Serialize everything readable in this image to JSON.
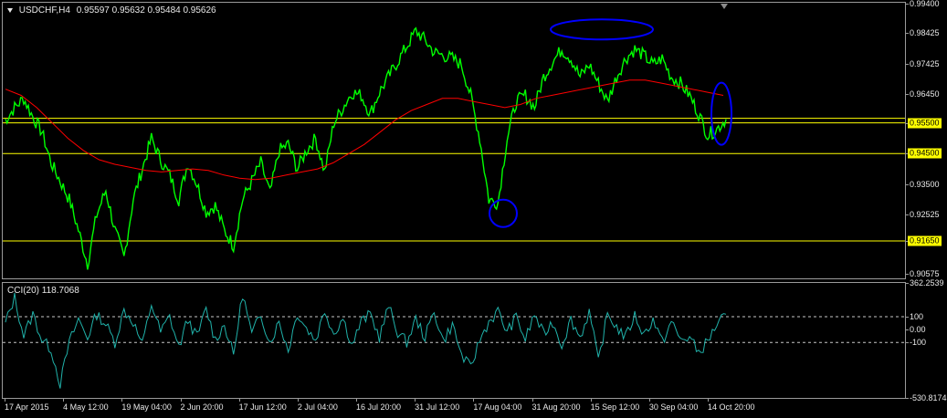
{
  "header": {
    "symbol": "USDCHF,H4",
    "ohlc": "0.95597 0.95632 0.95484 0.95626",
    "cci_label": "CCI(20) 118.7068"
  },
  "colors": {
    "price": "#00ff00",
    "ma": "#ff0000",
    "hline": "#ffff00",
    "ellipse": "#0000ff",
    "cci": "#20b2aa",
    "grid": "#9a9a9a"
  },
  "price_axis": {
    "ticks": [
      "0.99400",
      "0.98425",
      "0.97425",
      "0.96450",
      "0.95500",
      "0.94500",
      "0.93500",
      "0.92525",
      "0.91650",
      "0.90575"
    ],
    "ylim": [
      0.9043,
      0.9942
    ]
  },
  "cci_axis": {
    "ticks": [
      "362.2539",
      "100",
      "0.00",
      "-100",
      "-530.8174"
    ],
    "ylim": [
      -530.8174,
      362.2539
    ]
  },
  "time_axis": {
    "labels": [
      "17 Apr 2015",
      "4 May 12:00",
      "19 May 04:00",
      "2 Jun 20:00",
      "17 Jun 12:00",
      "2 Jul 04:00",
      "16 Jul 20:00",
      "31 Jul 12:00",
      "17 Aug 04:00",
      "31 Aug 20:00",
      "15 Sep 12:00",
      "30 Sep 04:00",
      "14 Oct 20:00"
    ]
  },
  "chart_data": {
    "type": "line",
    "title": "USDCHF,H4",
    "x": [
      "17 Apr 2015",
      "4 May 12:00",
      "19 May 04:00",
      "2 Jun 20:00",
      "17 Jun 12:00",
      "2 Jul 04:00",
      "16 Jul 20:00",
      "31 Jul 12:00",
      "17 Aug 04:00",
      "31 Aug 20:00",
      "15 Sep 12:00",
      "30 Sep 04:00",
      "14 Oct 20:00"
    ],
    "ylim": [
      0.9043,
      0.9942
    ],
    "grid": false,
    "series": [
      {
        "role": "price",
        "color": "#00ff00",
        "values": [
          0.956,
          0.96,
          0.963,
          0.957,
          0.952,
          0.942,
          0.936,
          0.93,
          0.92,
          0.909,
          0.925,
          0.933,
          0.92,
          0.911,
          0.93,
          0.94,
          0.95,
          0.943,
          0.938,
          0.93,
          0.942,
          0.935,
          0.926,
          0.928,
          0.92,
          0.915,
          0.93,
          0.936,
          0.942,
          0.932,
          0.946,
          0.948,
          0.94,
          0.946,
          0.95,
          0.939,
          0.955,
          0.96,
          0.965,
          0.964,
          0.958,
          0.965,
          0.97,
          0.975,
          0.98,
          0.985,
          0.982,
          0.978,
          0.977,
          0.976,
          0.974,
          0.964,
          0.95,
          0.93,
          0.929,
          0.95,
          0.962,
          0.964,
          0.96,
          0.97,
          0.975,
          0.979,
          0.976,
          0.97,
          0.974,
          0.968,
          0.962,
          0.97,
          0.976,
          0.979,
          0.977,
          0.974,
          0.976,
          0.97,
          0.968,
          0.964,
          0.958,
          0.951,
          0.953,
          0.9562
        ]
      },
      {
        "role": "moving-average",
        "color": "#ff0000",
        "values": [
          0.966,
          0.964,
          0.96,
          0.955,
          0.95,
          0.946,
          0.943,
          0.9415,
          0.9405,
          0.9395,
          0.939,
          0.9395,
          0.94,
          0.9395,
          0.938,
          0.937,
          0.9365,
          0.937,
          0.938,
          0.939,
          0.94,
          0.942,
          0.945,
          0.948,
          0.952,
          0.956,
          0.959,
          0.961,
          0.963,
          0.963,
          0.962,
          0.961,
          0.96,
          0.961,
          0.963,
          0.964,
          0.965,
          0.966,
          0.967,
          0.968,
          0.969,
          0.969,
          0.968,
          0.967,
          0.966,
          0.965,
          0.964
        ]
      }
    ],
    "horizontal_lines": [
      {
        "value": 0.9565,
        "label": ""
      },
      {
        "value": 0.955,
        "label": "0.95500"
      },
      {
        "value": 0.945,
        "label": "0.94500"
      },
      {
        "value": 0.9165,
        "label": "0.91650"
      }
    ],
    "cci": {
      "name": "CCI(20)",
      "last": 118.7068,
      "levels": [
        100,
        -100
      ],
      "ylim": [
        -530.8174,
        362.2539
      ],
      "values": [
        50,
        250,
        -50,
        120,
        -80,
        -150,
        -420,
        -100,
        80,
        -60,
        120,
        40,
        -100,
        150,
        60,
        -120,
        200,
        -20,
        100,
        -140,
        80,
        -60,
        160,
        -80,
        40,
        -200,
        280,
        -40,
        120,
        -100,
        60,
        -160,
        130,
        10,
        -80,
        150,
        -30,
        90,
        -120,
        60,
        120,
        -60,
        180,
        -20,
        -100,
        80,
        -60,
        140,
        -90,
        40,
        -200,
        -300,
        -80,
        60,
        140,
        -20,
        100,
        -80,
        120,
        -40,
        60,
        -120,
        80,
        -60,
        140,
        -250,
        120,
        20,
        -60,
        110,
        -40,
        80,
        -100,
        60,
        -80,
        -60,
        -180,
        -90,
        40,
        119
      ]
    },
    "annotations": [
      {
        "shape": "ellipse",
        "near": "31 Aug 20:00 - 15 Sep 12:00 highs",
        "color": "#0000ff"
      },
      {
        "shape": "ellipse",
        "near": "17 Aug 04:00 low",
        "color": "#0000ff"
      },
      {
        "shape": "ellipse",
        "near": "14 Oct 20:00 last price",
        "color": "#0000ff"
      }
    ]
  }
}
